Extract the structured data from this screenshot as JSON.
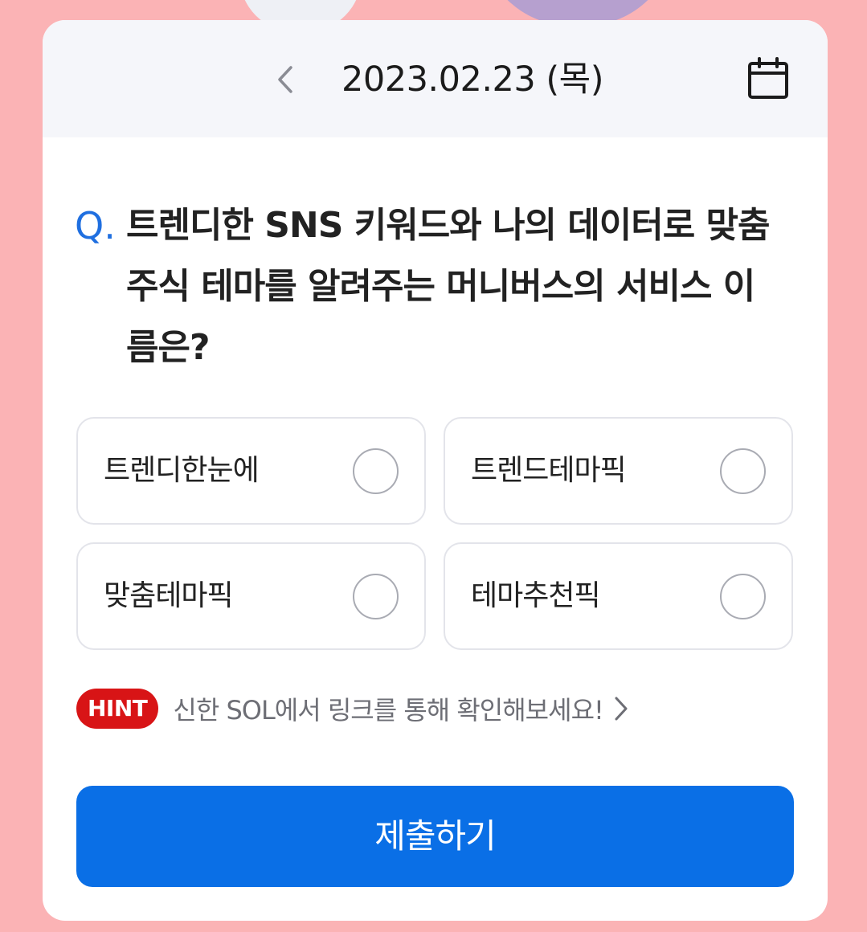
{
  "header": {
    "date": "2023.02.23 (목)",
    "prev_icon": "chevron-left-icon",
    "calendar_icon": "calendar-icon"
  },
  "question": {
    "prefix": "Q.",
    "text": "트렌디한 SNS 키워드와 나의 데이터로 맞춤 주식 테마를 알려주는 머니버스의 서비스 이름은?"
  },
  "options": [
    {
      "label": "트렌디한눈에",
      "selected": false
    },
    {
      "label": "트렌드테마픽",
      "selected": false
    },
    {
      "label": "맞춤테마픽",
      "selected": false
    },
    {
      "label": "테마추천픽",
      "selected": false
    }
  ],
  "hint": {
    "badge": "HINT",
    "text": "신한 SOL에서 링크를 통해 확인해보세요!",
    "chevron_icon": "chevron-right-icon"
  },
  "submit": {
    "label": "제출하기"
  },
  "colors": {
    "background": "#fbb3b5",
    "accent": "#0a6fe6",
    "question_mark": "#1f6fe0",
    "hint_badge": "#d81416"
  }
}
